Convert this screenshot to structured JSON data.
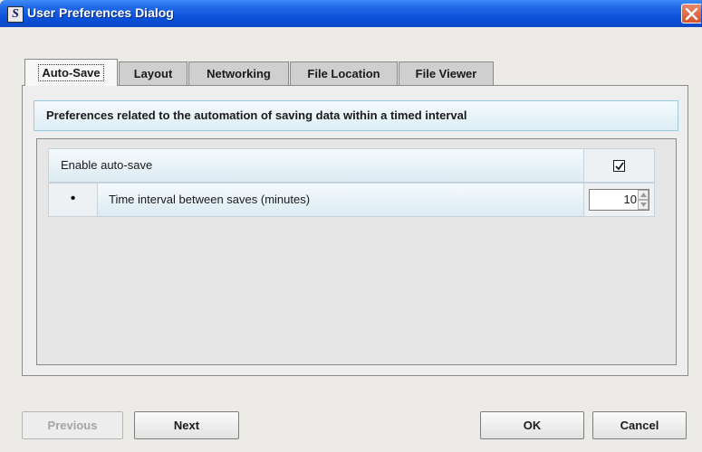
{
  "window": {
    "title": "User Preferences Dialog",
    "app_icon_letter": "S"
  },
  "tabs": [
    {
      "label": "Auto-Save",
      "active": true
    },
    {
      "label": "Layout",
      "active": false
    },
    {
      "label": "Networking",
      "active": false
    },
    {
      "label": "File Location",
      "active": false
    },
    {
      "label": "File Viewer",
      "active": false
    }
  ],
  "panel": {
    "description": "Preferences related to the automation of saving data within a timed interval",
    "settings": {
      "enable_autosave_label": "Enable auto-save",
      "enable_autosave_checked": true,
      "bullet": "•",
      "interval_label": "Time interval between saves (minutes)",
      "interval_value": "10"
    }
  },
  "footer": {
    "previous_label": "Previous",
    "next_label": "Next",
    "ok_label": "OK",
    "cancel_label": "Cancel"
  },
  "colors": {
    "titlebar": "#0a50d8",
    "info_dot": "#3b86e0",
    "close_button": "#d2542e"
  }
}
